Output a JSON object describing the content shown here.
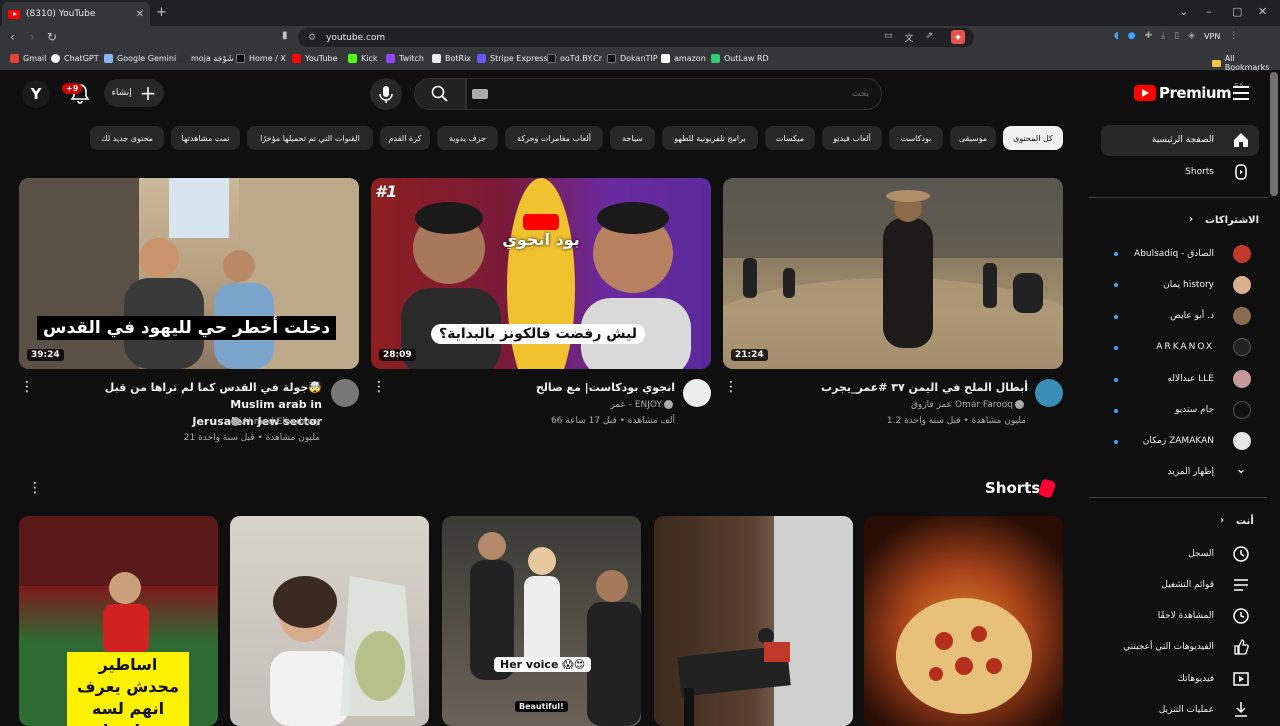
{
  "browser": {
    "tab_title": "(8310) YouTube",
    "tab_close": "✕",
    "new_tab": "+",
    "url": "youtube.com",
    "vpn_label": "VPN",
    "bookmarks": [
      "Gmail",
      "ChatGPT",
      "Google Gemini",
      "moja شَوْجَة",
      "Home / X",
      "YouTube",
      "Kick",
      "Twitch",
      "BotRix",
      "Stripe Express",
      "ooTd.BY.Cr",
      "DokanTIP",
      "amazon",
      "OutLaw RD"
    ],
    "all_bookmarks": "All Bookmarks"
  },
  "header": {
    "avatar_letter": "Y",
    "notifications_badge": "+9",
    "create_label": "إنشاء",
    "search_placeholder": "بحث",
    "logo_text": "Premium",
    "logo_region": "SA"
  },
  "chips": [
    "كل المحتوى",
    "موسيقى",
    "بودكاست",
    "ألعاب فيديو",
    "ميكسات",
    "برامج تلفزيونية للطهو",
    "سياحة",
    "ألعاب مغامرات وحركة",
    "جزف يدوية",
    "كرة القدم",
    "القنوات التي تم تحميلها مؤخرًا",
    "تمت مشاهدتها",
    "محتوى جديد لك"
  ],
  "videos": [
    {
      "title": "أبطال الملح في اليمن ٣٧ #عمر_يجرب",
      "channel": "عمر فاروق Omar Farooq",
      "meta": "1.2 مليون مشاهدة • قبل سنة واحدة",
      "duration": "21:24",
      "thumb_text": ""
    },
    {
      "title": "انجوي بودكاست| مع صالح",
      "channel": "عمر - ENJOY",
      "meta": "66 ألف مشاهدة • قبل 17 ساعة",
      "duration": "28:09",
      "thumb_text": "ليش رفضت فالكونز بالبداية؟",
      "thumb_badge": "#1",
      "thumb_brand": "بود انجوي"
    },
    {
      "title_line1": "جولة في القدس كما لم تراها من قبل🤯 Muslim arab in",
      "title_line2": "Jerusalem Jew sector",
      "channel": "Ahmed Elbadawy",
      "meta": "21 مليون مشاهدة • قبل سنة واحدة",
      "duration": "39:24",
      "thumb_text": "دخلت أخطر حي لليهود في القدس"
    }
  ],
  "shorts": {
    "title": "Shorts",
    "items": [
      {
        "caption": "اساطير محدش يعرف انهم لسه بيلعبوا"
      },
      {
        "caption": ""
      },
      {
        "caption": "Her voice 😱😍",
        "caption2": "Beautiful!"
      },
      {
        "caption": ""
      },
      {
        "caption": ""
      }
    ]
  },
  "sidebar": {
    "home": "الصفحة الرئيسية",
    "shorts": "Shorts",
    "subscriptions_head": "الاشتراكات",
    "subscriptions": [
      "Abulsadiq - الصادق",
      "يمان history",
      "د. أبو عايض",
      "ARKANOX",
      "عبدالاله LLE",
      "جام ستديو",
      "زمكان ZAMAKAN"
    ],
    "show_more": "إظهار المزيد",
    "you_head": "أنت",
    "you_items": [
      "السجل",
      "قوائم التشغيل",
      "المشاهدة لاحقًا",
      "الفيديوهات التي أعجبتني",
      "فيديوهاتك",
      "عمليات التنزيل"
    ]
  },
  "colors": {
    "background": "#0f0f0f",
    "chip_bg": "#272727",
    "accent_red": "#ff0000",
    "text_secondary": "#aaaaaa"
  }
}
